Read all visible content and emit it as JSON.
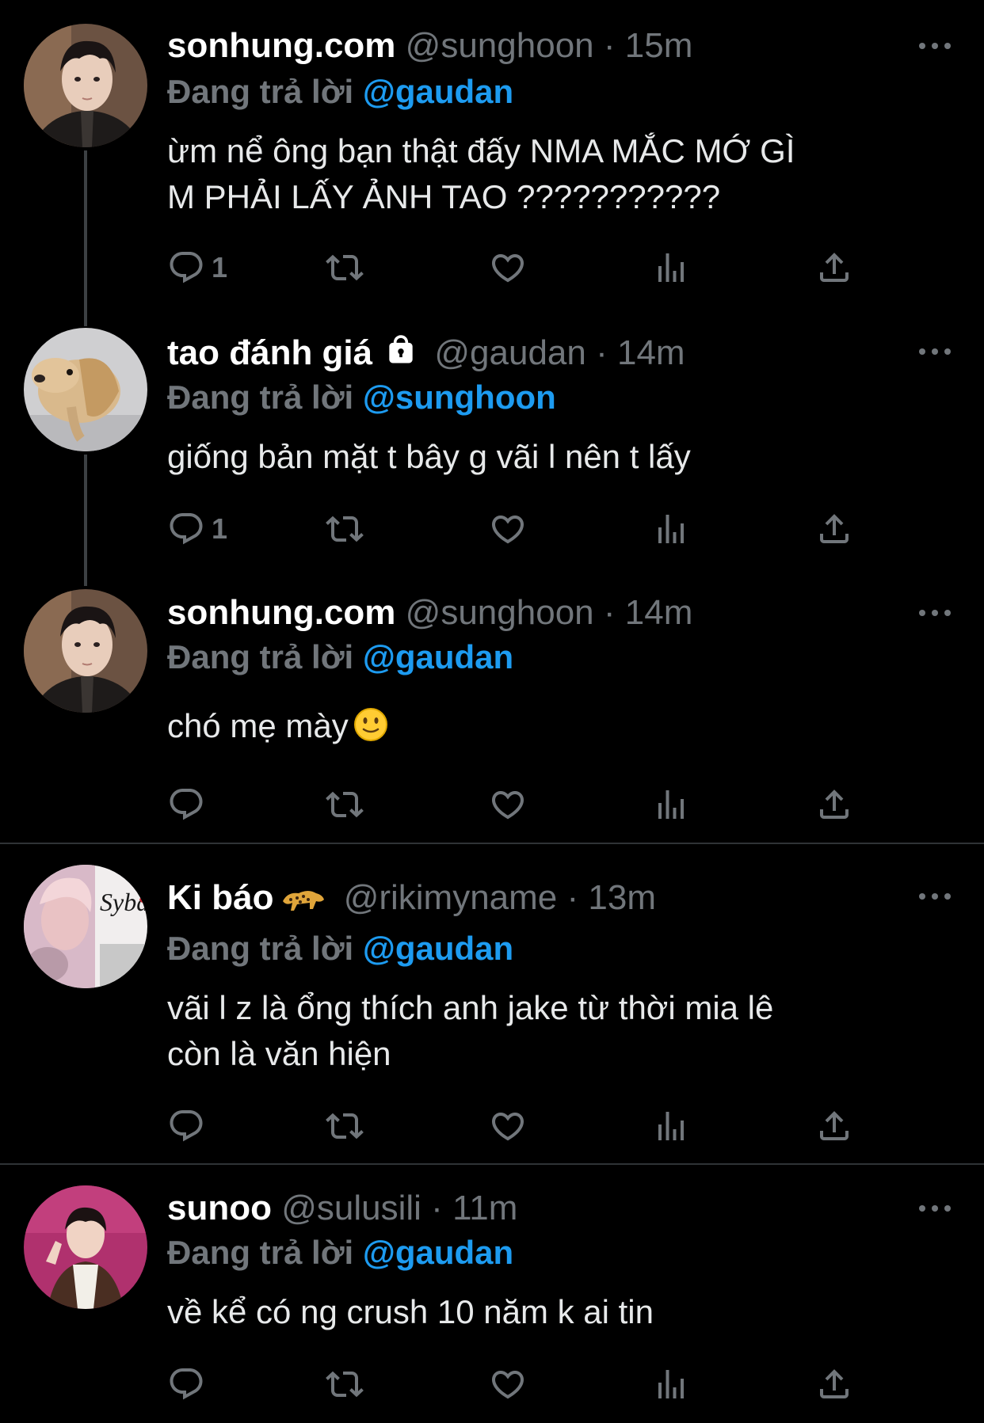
{
  "tweets": [
    {
      "name": "sonhung.com",
      "handle": "@sunghoon",
      "dot": "·",
      "time": "15m",
      "reply_prefix": "Đang trả lời",
      "reply_mention": "@gaudan",
      "text_line1": "ừm nể ông bạn thật đấy NMA MẮC MỚ GÌ",
      "text_line2": "M PHẢI LẤY ẢNH TAO ???????????",
      "reply_count": "1"
    },
    {
      "name": "tao đánh giá",
      "handle": "@gaudan",
      "dot": "·",
      "time": "14m",
      "reply_prefix": "Đang trả lời",
      "reply_mention": "@sunghoon",
      "text_line1": "giống bản mặt t bây g vãi l nên t lấy",
      "reply_count": "1"
    },
    {
      "name": "sonhung.com",
      "handle": "@sunghoon",
      "dot": "·",
      "time": "14m",
      "reply_prefix": "Đang trả lời",
      "reply_mention": "@gaudan",
      "text_line1": "chó mẹ mày"
    },
    {
      "name": "Ki báo",
      "handle": "@rikimyname",
      "dot": "·",
      "time": "13m",
      "reply_prefix": "Đang trả lời",
      "reply_mention": "@gaudan",
      "text_line1": "vãi l z là ổng thích anh jake từ thời mia lê",
      "text_line2": "còn là văn hiện",
      "avatar_text": "Sybau"
    },
    {
      "name": "sunoo",
      "handle": "@sulusili",
      "dot": "·",
      "time": "11m",
      "reply_prefix": "Đang trả lời",
      "reply_mention": "@gaudan",
      "text_line1": "về kể có ng crush 10 năm k ai tin"
    }
  ],
  "icons": [
    "reply-icon",
    "retweet-icon",
    "like-icon",
    "views-icon",
    "share-icon",
    "more-icon",
    "lock-icon",
    "leopard-icon",
    "smiley-icon"
  ],
  "colors": {
    "background": "#000000",
    "mention": "#1d9bf0",
    "secondary": "#71767b",
    "separator": "#2f3336"
  }
}
